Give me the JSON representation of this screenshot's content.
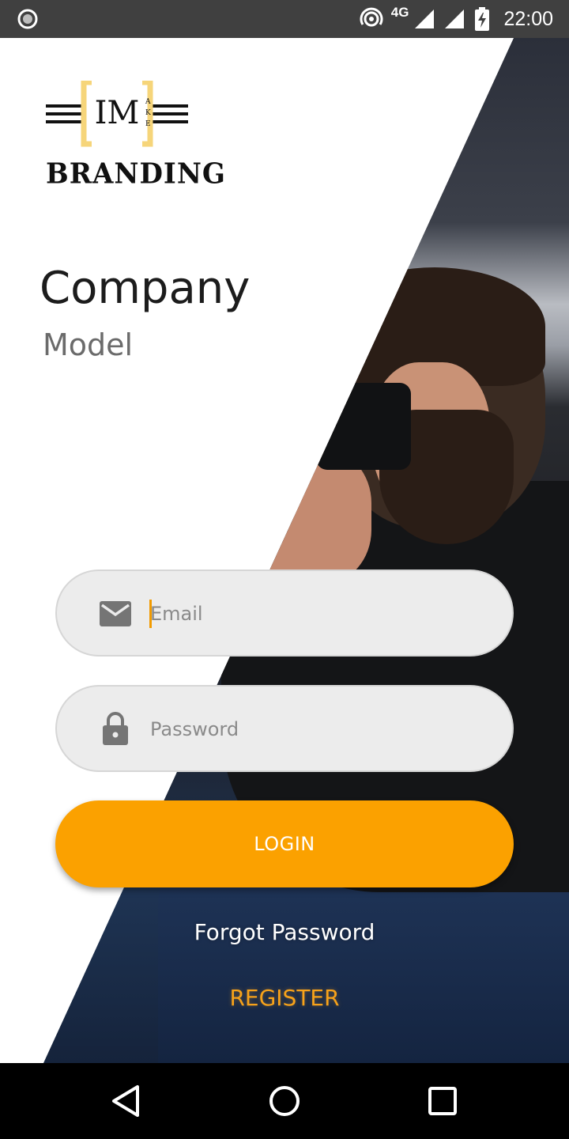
{
  "status_bar": {
    "time": "22:00",
    "network": "4G"
  },
  "brand": {
    "logo_letters": "IM",
    "logo_side_letters": "AKE",
    "logo_name": "BRANDING",
    "accent_color": "#f6d57a"
  },
  "header": {
    "title": "Company",
    "subtitle": "Model"
  },
  "form": {
    "email_placeholder": "Email",
    "password_placeholder": "Password",
    "login_label": "LOGIN",
    "forgot_label": "Forgot Password",
    "register_label": "REGISTER"
  },
  "colors": {
    "primary": "#fba100",
    "field_bg": "#ececec",
    "status_bar": "#404040"
  },
  "icons": {
    "email": "envelope-icon",
    "password": "lock-icon"
  }
}
